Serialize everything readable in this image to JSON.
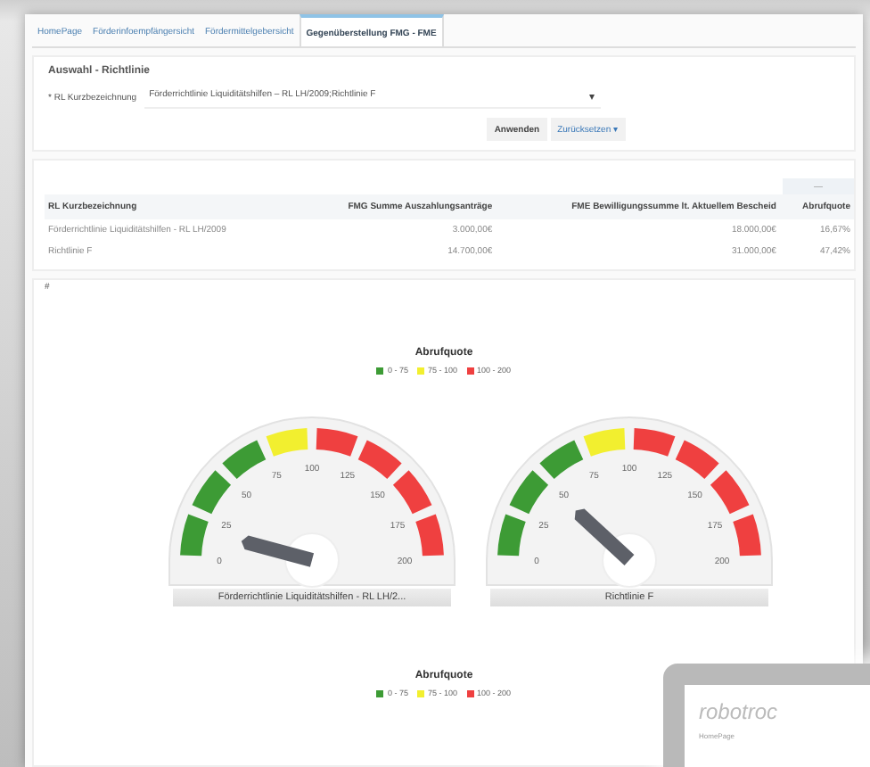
{
  "tabs": [
    {
      "label": "HomePage",
      "selected": false
    },
    {
      "label": "Förderinfoempfängersicht",
      "selected": false
    },
    {
      "label": "Fördermittelgebersicht",
      "selected": false
    },
    {
      "label": "Gegenüberstellung FMG - FME",
      "selected": true
    }
  ],
  "filter": {
    "title": "Auswahl - Richtlinie",
    "label": "* RL Kurzbezeichnung",
    "value": "Förderrichtlinie Liquiditätshilfen – RL LH/2009;Richtlinie F",
    "caret": "▾",
    "buttons": [
      {
        "label": "Anwenden",
        "kind": "primary"
      },
      {
        "label": "Zurücksetzen ▾",
        "kind": "link"
      }
    ]
  },
  "table": {
    "menu": "—",
    "columns": [
      "RL Kurzbezeichnung",
      "FMG Summe Auszahlungsanträge",
      "FME Bewilligungssumme lt. Aktuellem Bescheid",
      "Abrufquote"
    ],
    "rows": [
      [
        "Förderrichtlinie Liquiditätshilfen - RL LH/2009",
        "3.000,00€",
        "18.000,00€",
        "16,67%"
      ],
      [
        "Richtlinie F",
        "14.700,00€",
        "31.000,00€",
        "47,42%"
      ]
    ]
  },
  "chart_panel": {
    "marker": "#",
    "title": "Abrufquote",
    "legend": [
      {
        "label": "0 - 75",
        "color": "#3d9b35"
      },
      {
        "label": "75 - 100",
        "color": "#f2ef2f"
      },
      {
        "label": "100 - 200",
        "color": "#ef4040"
      }
    ],
    "gauges": [
      {
        "label": "Förderrichtlinie Liquiditätshilfen - RL LH/2...",
        "ticks": [
          "0",
          "25",
          "50",
          "75",
          "100",
          "125",
          "150",
          "175",
          "200"
        ]
      },
      {
        "label": "Richtlinie F",
        "ticks": [
          "0",
          "25",
          "50",
          "75",
          "100",
          "125",
          "150",
          "175",
          "200"
        ]
      }
    ]
  },
  "chart_panel_2": {
    "title": "Abrufquote",
    "legend": [
      {
        "label": "0 - 75",
        "color": "#3d9b35"
      },
      {
        "label": "75 - 100",
        "color": "#f2ef2f"
      },
      {
        "label": "100 - 200",
        "color": "#ef4040"
      }
    ]
  },
  "overlay_window": {
    "title": "robotroc",
    "subtitle": "HomePage"
  }
}
